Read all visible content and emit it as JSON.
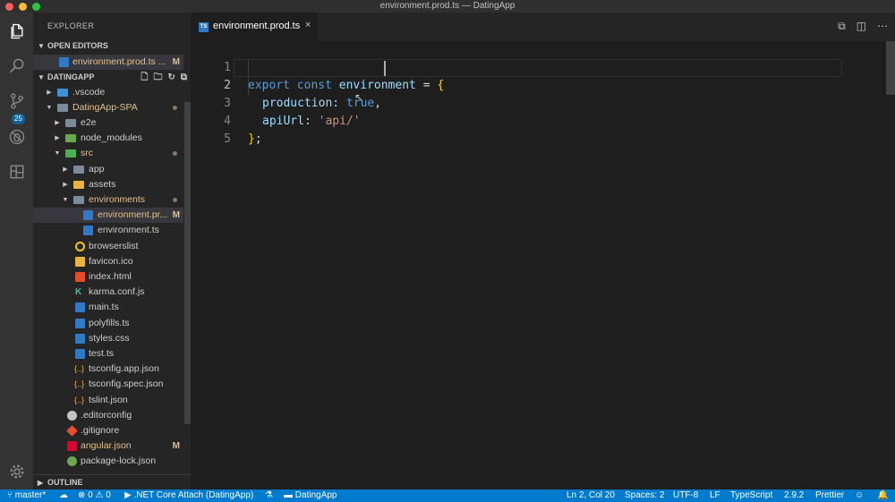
{
  "window": {
    "title": "environment.prod.ts — DatingApp"
  },
  "activity_bar": {
    "items": [
      "files-icon",
      "search-icon",
      "source-control-icon",
      "debug-icon",
      "extensions-icon"
    ],
    "badge": "25"
  },
  "sidebar": {
    "header": "EXPLORER",
    "open_editors": {
      "label": "OPEN EDITORS",
      "items": [
        {
          "name": "environment.prod.ts ...",
          "status": "M"
        }
      ]
    },
    "project": {
      "label": "DATINGAPP",
      "tree": [
        {
          "name": ".vscode",
          "status": ""
        },
        {
          "name": "DatingApp-SPA",
          "status": ""
        },
        {
          "name": "e2e",
          "status": ""
        },
        {
          "name": "node_modules",
          "status": ""
        },
        {
          "name": "src",
          "status": ""
        },
        {
          "name": "app",
          "status": ""
        },
        {
          "name": "assets",
          "status": ""
        },
        {
          "name": "environments",
          "status": ""
        },
        {
          "name": "environment.pr...",
          "status": "M"
        },
        {
          "name": "environment.ts",
          "status": ""
        },
        {
          "name": "browserslist",
          "status": ""
        },
        {
          "name": "favicon.ico",
          "status": ""
        },
        {
          "name": "index.html",
          "status": ""
        },
        {
          "name": "karma.conf.js",
          "status": ""
        },
        {
          "name": "main.ts",
          "status": ""
        },
        {
          "name": "polyfills.ts",
          "status": ""
        },
        {
          "name": "styles.css",
          "status": ""
        },
        {
          "name": "test.ts",
          "status": ""
        },
        {
          "name": "tsconfig.app.json",
          "status": ""
        },
        {
          "name": "tsconfig.spec.json",
          "status": ""
        },
        {
          "name": "tslint.json",
          "status": ""
        },
        {
          "name": ".editorconfig",
          "status": ""
        },
        {
          "name": ".gitignore",
          "status": ""
        },
        {
          "name": "angular.json",
          "status": "M"
        },
        {
          "name": "package-lock.json",
          "status": ""
        }
      ]
    },
    "outline_label": "OUTLINE"
  },
  "tabs": [
    {
      "label": "environment.prod.ts",
      "close": "×"
    }
  ],
  "editor": {
    "lines": [
      {
        "number": "1",
        "text": "export const environment = {"
      },
      {
        "number": "2",
        "text": "production: true,"
      },
      {
        "number": "3",
        "text": "apiUrl: 'api/'"
      },
      {
        "number": "4",
        "text": "};"
      },
      {
        "number": "5",
        "text": ""
      }
    ],
    "tokens": {
      "l1_export": "export",
      "l1_const": "const",
      "l1_var": "environment",
      "l1_eq": "=",
      "l1_brace": "{",
      "l2_prop": "production:",
      "l2_val": "true",
      "l2_comma": ",",
      "l3_prop": "apiUrl:",
      "l3_str": "'api/'",
      "l4_brace": "}",
      "l4_semi": ";"
    }
  },
  "status_bar": {
    "branch": "master*",
    "sync": "",
    "errors": "0",
    "warnings": "0",
    "debug": ".NET Core Attach (DatingApp)",
    "folder": "DatingApp",
    "position": "Ln 2, Col 20",
    "spaces": "Spaces: 2",
    "encoding": "UTF-8",
    "eol": "LF",
    "language": "TypeScript",
    "ts_version": "2.9.2",
    "formatter": "Prettier"
  },
  "colors": {
    "status_bar": "#007acc",
    "activity_bar": "#333333",
    "sidebar": "#252526",
    "editor": "#1e1e1e",
    "modified": "#e2c08d"
  }
}
